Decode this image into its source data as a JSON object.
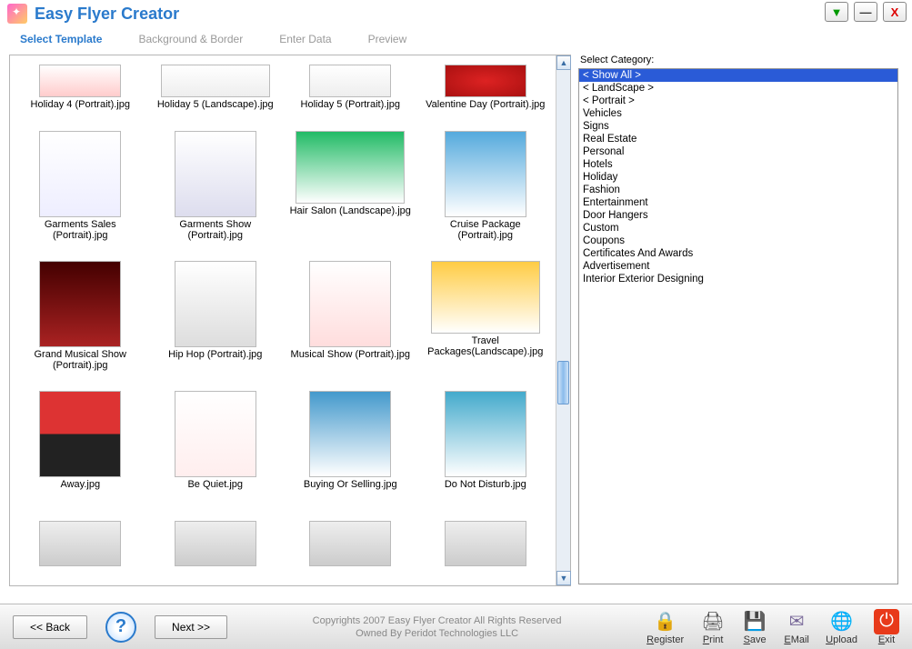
{
  "app": {
    "title": "Easy Flyer Creator"
  },
  "winButtons": {
    "dropdown": "▼",
    "minimize": "—",
    "close": "X"
  },
  "tabs": {
    "selectTemplate": "Select Template",
    "background": "Background & Border",
    "enterData": "Enter Data",
    "preview": "Preview"
  },
  "side": {
    "label": "Select Category:",
    "categories": [
      "< Show All >",
      "< LandScape >",
      "< Portrait >",
      "Vehicles",
      "Signs",
      "Real Estate",
      "Personal",
      "Hotels",
      "Holiday",
      "Fashion",
      "Entertainment",
      "Door Hangers",
      "Custom",
      "Coupons",
      "Certificates And Awards",
      "Advertisement",
      "Interior Exterior Designing"
    ],
    "selectedIndex": 0
  },
  "gallery": {
    "rows": [
      [
        {
          "label": "Holiday 4 (Portrait).jpg",
          "orient": "portrait"
        },
        {
          "label": "Holiday 5 (Landscape).jpg",
          "orient": "landscape"
        },
        {
          "label": "Holiday 5 (Portrait).jpg",
          "orient": "portrait"
        },
        {
          "label": "Valentine Day (Portrait).jpg",
          "orient": "portrait"
        }
      ],
      [
        {
          "label": "Garments Sales (Portrait).jpg",
          "orient": "portrait"
        },
        {
          "label": "Garments Show (Portrait).jpg",
          "orient": "portrait"
        },
        {
          "label": "Hair Salon (Landscape).jpg",
          "orient": "landscape"
        },
        {
          "label": "Cruise Package (Portrait).jpg",
          "orient": "portrait"
        }
      ],
      [
        {
          "label": "Grand Musical Show (Portrait).jpg",
          "orient": "portrait"
        },
        {
          "label": "Hip Hop (Portrait).jpg",
          "orient": "portrait"
        },
        {
          "label": "Musical Show (Portrait).jpg",
          "orient": "portrait"
        },
        {
          "label": "Travel Packages(Landscape).jpg",
          "orient": "landscape"
        }
      ],
      [
        {
          "label": "Away.jpg",
          "orient": "portrait"
        },
        {
          "label": "Be Quiet.jpg",
          "orient": "portrait"
        },
        {
          "label": "Buying Or Selling.jpg",
          "orient": "portrait"
        },
        {
          "label": "Do Not Disturb.jpg",
          "orient": "portrait"
        }
      ],
      [
        {
          "label": "",
          "orient": "portrait"
        },
        {
          "label": "",
          "orient": "portrait"
        },
        {
          "label": "",
          "orient": "portrait"
        },
        {
          "label": "",
          "orient": "portrait"
        }
      ]
    ]
  },
  "footer": {
    "back": "<< Back",
    "next": "Next >>",
    "copyright1": "Copyrights 2007 Easy Flyer Creator All Rights Reserved",
    "copyright2": "Owned By Peridot Technologies LLC",
    "actions": {
      "register": {
        "label": "Register",
        "u": "R"
      },
      "print": {
        "label": "Print",
        "u": "P"
      },
      "save": {
        "label": "Save",
        "u": "S"
      },
      "email": {
        "label": "EMail",
        "u": "E"
      },
      "upload": {
        "label": "Upload",
        "u": "U"
      },
      "exit": {
        "label": "Exit",
        "u": "E"
      }
    }
  }
}
